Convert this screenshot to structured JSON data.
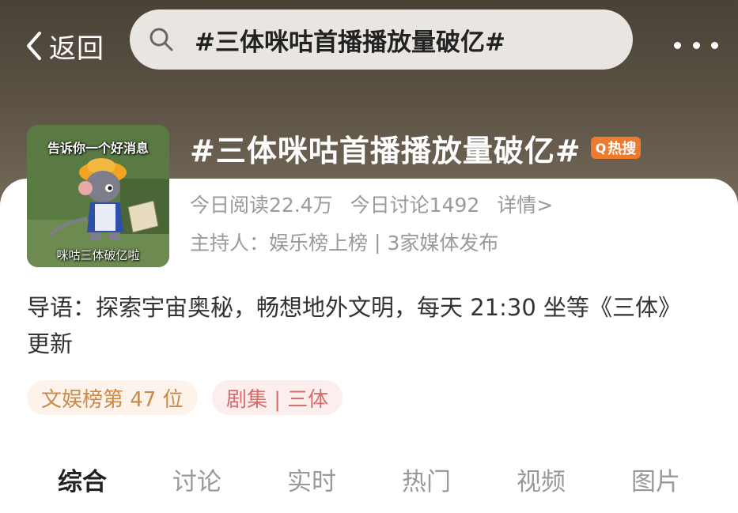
{
  "topbar": {
    "back_label": "返回",
    "search_text": "#三体咪咕首播播放量破亿#"
  },
  "thumbnail": {
    "top_caption": "告诉你一个好消息",
    "bottom_caption": "咪咕三体破亿啦"
  },
  "topic": {
    "title": "#三体咪咕首播播放量破亿#",
    "badge": "热搜",
    "reads": "今日阅读22.4万",
    "discussions": "今日讨论1492",
    "details": "详情>",
    "host": "主持人：娱乐榜上榜",
    "media": "3家媒体发布"
  },
  "intro": "导语：探索宇宙奥秘，畅想地外文明，每天 21:30 坐等《三体》更新",
  "tags": {
    "rank": "文娱榜第 47 位",
    "drama": "剧集 | 三体"
  },
  "tabs": [
    "综合",
    "讨论",
    "实时",
    "热门",
    "视频",
    "图片"
  ],
  "colors": {
    "hot_badge": "#ef7a2d",
    "rank_tag_text": "#c98a4a",
    "drama_tag_text": "#d96b6b"
  }
}
